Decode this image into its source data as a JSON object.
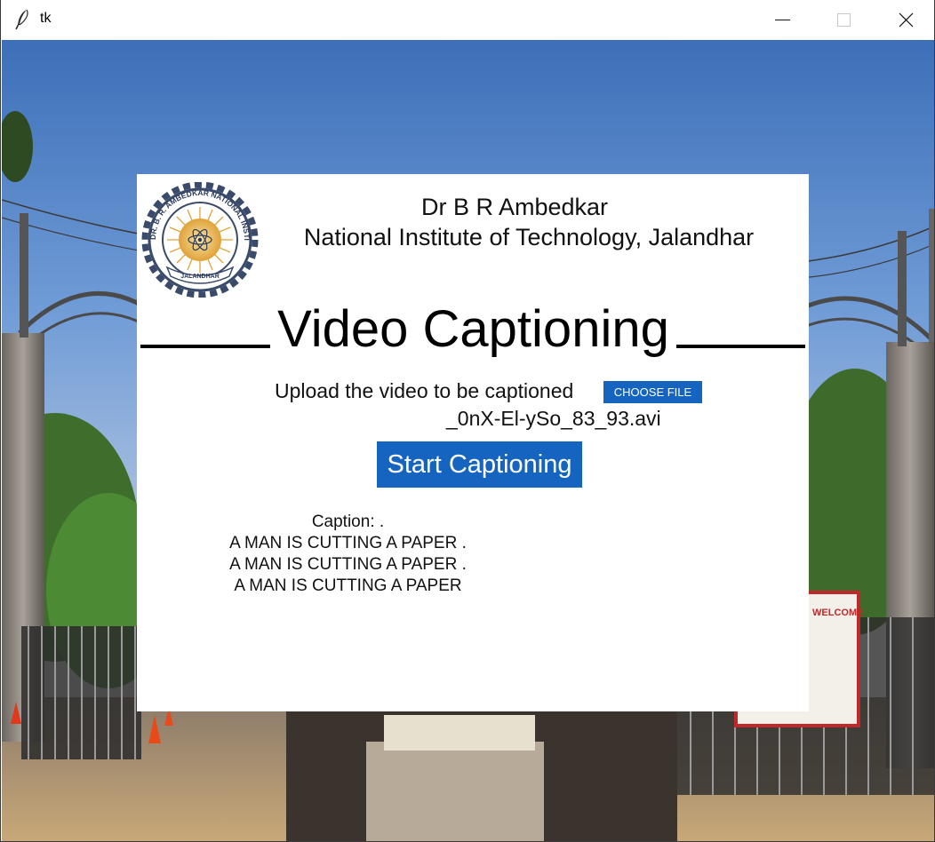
{
  "window": {
    "title": "tk",
    "icon": "feather-icon",
    "controls": [
      "minimize-icon",
      "maximize-icon",
      "close-icon"
    ]
  },
  "header": {
    "institute_line1": "Dr B R Ambedkar",
    "institute_line2": "National Institute of Technology, Jalandhar",
    "logo_text": "DR. B. R. AMBEDKAR NATIONAL INSTITUTE OF TECHNOLOGY",
    "logo_banner": "JALANDHAR"
  },
  "main": {
    "title": "Video Captioning",
    "upload_label": "Upload the video to be captioned",
    "choose_file_label": "CHOOSE FILE",
    "selected_file": "_0nX-El-ySo_83_93.avi",
    "start_button_label": "Start Captioning"
  },
  "caption": {
    "heading": "Caption: .",
    "lines": [
      "A MAN IS CUTTING A PAPER .",
      "A MAN IS CUTTING A PAPER .",
      "A MAN IS CUTTING A PAPER"
    ]
  },
  "background": {
    "sign_text": "WELCOME"
  },
  "colors": {
    "accent_button": "#1565c0",
    "panel": "#ffffff",
    "sky": "#4f7fc4"
  }
}
